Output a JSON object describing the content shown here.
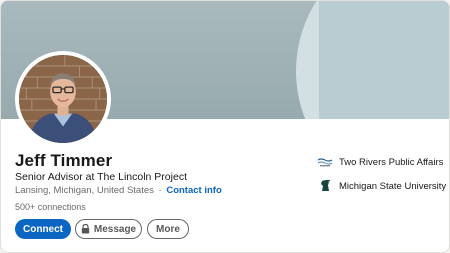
{
  "profile": {
    "name": "Jeff Timmer",
    "headline": "Senior Advisor at The Lincoln Project",
    "location": "Lansing, Michigan, United States",
    "separator": "·",
    "contact_info": "Contact info",
    "connections": "500+ connections"
  },
  "actions": {
    "connect": "Connect",
    "message": "Message",
    "more": "More"
  },
  "orgs": [
    {
      "name": "Two Rivers Public Affairs",
      "icon": "two-rivers-logo"
    },
    {
      "name": "Michigan State University",
      "icon": "msu-spartan-logo"
    }
  ],
  "colors": {
    "primary": "#0a66c2",
    "banner": "#9fb4b8",
    "msu_green": "#18453b"
  }
}
